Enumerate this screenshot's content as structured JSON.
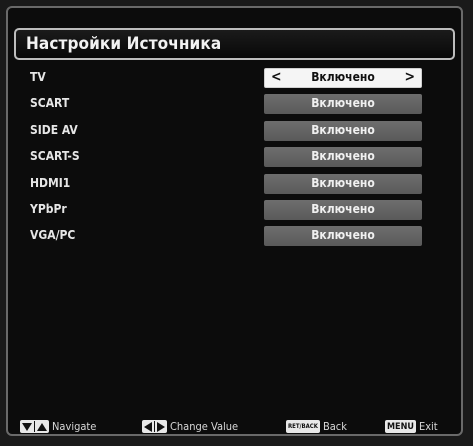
{
  "title": "Настройки Источника",
  "sources": [
    {
      "label": "TV",
      "value": "Включено",
      "selected": true
    },
    {
      "label": "SCART",
      "value": "Включено",
      "selected": false
    },
    {
      "label": "SIDE AV",
      "value": "Включено",
      "selected": false
    },
    {
      "label": "SCART-S",
      "value": "Включено",
      "selected": false
    },
    {
      "label": "HDMI1",
      "value": "Включено",
      "selected": false
    },
    {
      "label": "YPbPr",
      "value": "Включено",
      "selected": false
    },
    {
      "label": "VGA/PC",
      "value": "Включено",
      "selected": false
    }
  ],
  "footer": {
    "navigate_label": "Navigate",
    "change_value_label": "Change Value",
    "back_key": "RET/BACK",
    "back_label": "Back",
    "menu_key": "MENU",
    "exit_label": "Exit"
  },
  "arrows": {
    "left": "<",
    "right": ">"
  }
}
